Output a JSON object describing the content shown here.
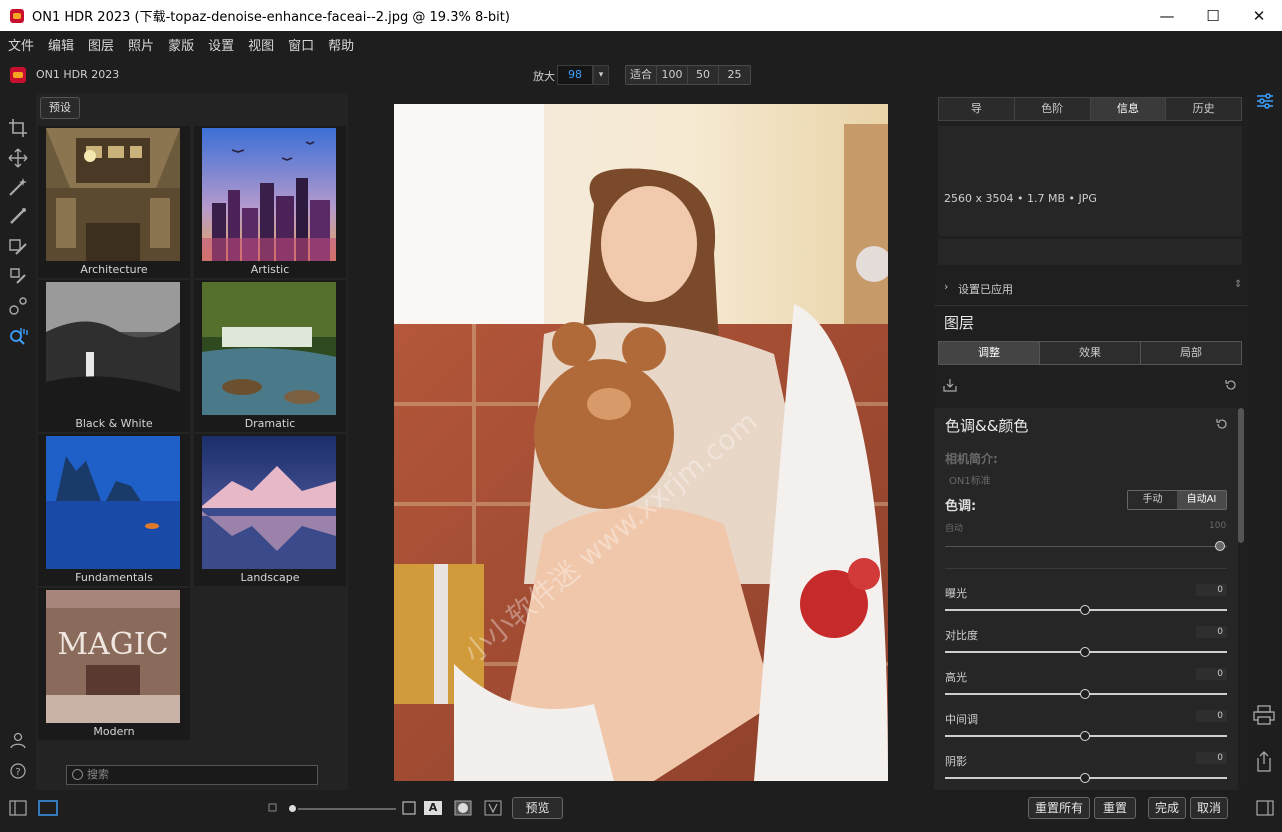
{
  "window": {
    "title": "ON1 HDR 2023 (下载-topaz-denoise-enhance-faceai--2.jpg @ 19.3% 8-bit)",
    "minimize": "—",
    "maximize": "☐",
    "close": "✕"
  },
  "menu": [
    "文件",
    "编辑",
    "图层",
    "照片",
    "蒙版",
    "设置",
    "视图",
    "窗口",
    "帮助"
  ],
  "appbar": {
    "app_name": "ON1 HDR 2023",
    "zoom_label": "放大",
    "zoom_value": "98",
    "zoom_presets": [
      "适合",
      "100",
      "50",
      "25"
    ]
  },
  "presets": {
    "tab_label": "预设",
    "items": [
      "Architecture",
      "Artistic",
      "Black & White",
      "Dramatic",
      "Fundamentals",
      "Landscape",
      "Modern"
    ],
    "magic_text": "MAGIC",
    "search_placeholder": "搜索"
  },
  "bottom": {
    "preview_label": "预览",
    "mask_letter": "A",
    "reset_all": "重置所有",
    "reset": "重置",
    "done": "完成",
    "cancel": "取消"
  },
  "right": {
    "tabs": [
      "导",
      "色阶",
      "信息",
      "历史"
    ],
    "active_tab": "信息",
    "info_text": "2560 x 3504 • 1.7 MB • JPG",
    "settings_applied": "设置已应用",
    "layers_title": "图层",
    "layer_tabs": [
      "调整",
      "效果",
      "局部"
    ],
    "section_title": "色调&&颜色",
    "camera_profile_label": "相机简介:",
    "camera_profile_value": "ON1标准",
    "tone_label": "色调:",
    "tone_manual": "手动",
    "tone_auto": "自动AI",
    "auto_label": "自动",
    "auto_value": "100",
    "sliders": [
      {
        "label": "曝光",
        "value": "0"
      },
      {
        "label": "对比度",
        "value": "0"
      },
      {
        "label": "高光",
        "value": "0"
      },
      {
        "label": "中间调",
        "value": "0"
      },
      {
        "label": "阴影",
        "value": "0"
      }
    ]
  },
  "watermark": "小小软件迷 www.xxrjm.com"
}
